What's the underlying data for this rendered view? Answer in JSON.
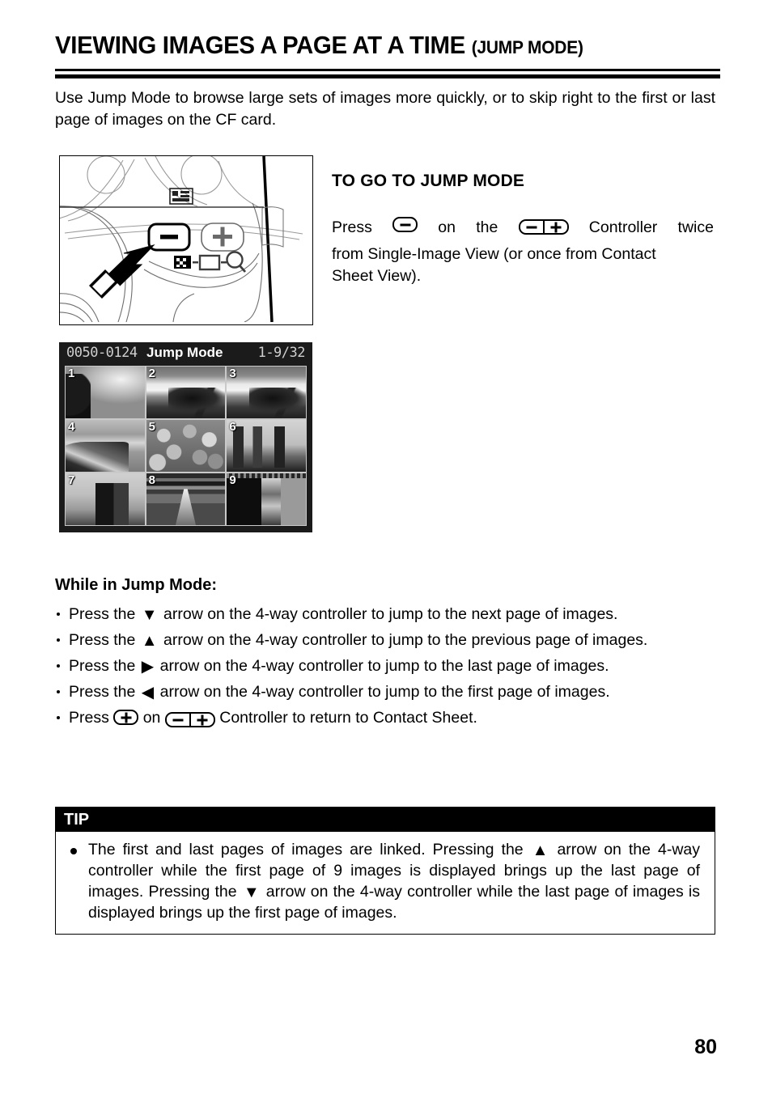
{
  "page": {
    "title_main": "VIEWING IMAGES A PAGE AT A TIME",
    "title_sub": "(JUMP MODE)",
    "number": "80"
  },
  "intro": {
    "text": "Use Jump Mode to browse large sets of images more quickly, or to skip right to the first or last page of images on the CF card."
  },
  "camera_figure": {
    "name": "camera-back-diagram",
    "minus_button_label": "−",
    "plus_button_label": "+",
    "icons": [
      "contact-sheet-icon",
      "single-image-icon",
      "magnifier-icon",
      "display-mode-icon"
    ],
    "callout": "arrow-pointing-to-minus-button"
  },
  "lcd_figure": {
    "counter": "0050-0124",
    "mode": "Jump Mode",
    "range": "1-9/32",
    "thumbnails": [
      {
        "number": "1",
        "caption": "tree-silhouette-and-clouds"
      },
      {
        "number": "2",
        "caption": "bridge-arch-and-sky"
      },
      {
        "number": "3",
        "caption": "bridge-arch-and-sky"
      },
      {
        "number": "4",
        "caption": "boat-at-shoreline"
      },
      {
        "number": "5",
        "caption": "rocks-close-up"
      },
      {
        "number": "6",
        "caption": "city-buildings"
      },
      {
        "number": "7",
        "caption": "tower-against-clouds"
      },
      {
        "number": "8",
        "caption": "railway-tracks"
      },
      {
        "number": "9",
        "caption": "dark-street-scene"
      }
    ]
  },
  "to_go_to": {
    "heading": "TO GO TO JUMP MODE",
    "line1_a": "Press",
    "line1_b": "on",
    "line1_c": "the",
    "line1_d": "Controller",
    "line1_e": "twice",
    "line2": "from Single-Image View (or once from Contact",
    "line3": "Sheet View)."
  },
  "while_in": {
    "heading": "While in Jump Mode:",
    "bullets": [
      {
        "prefix": "Press the",
        "glyph": "▼",
        "glyph_name": "down-arrow-glyph",
        "suffix": "arrow on the 4-way controller to jump to the next page of images."
      },
      {
        "prefix": "Press the",
        "glyph": "▲",
        "glyph_name": "up-arrow-glyph",
        "suffix": "arrow on the 4-way controller to jump to the previous page of images."
      },
      {
        "prefix": "Press the",
        "glyph": "▶",
        "glyph_name": "right-arrow-glyph",
        "suffix": "arrow on the 4-way controller to jump to the last page of images."
      },
      {
        "prefix": "Press the",
        "glyph": "◀",
        "glyph_name": "left-arrow-glyph",
        "suffix": "arrow on the 4-way controller to jump to the first page of images."
      }
    ],
    "last_bullet": {
      "a": "Press",
      "b": "on",
      "c": "Controller to return to Contact Sheet."
    }
  },
  "tip": {
    "header": "TIP",
    "text_a": "The first and last pages of images are linked.   Pressing the",
    "glyph_up": "▲",
    "text_b": "arrow on the 4-way controller while the first page of 9 images is displayed brings up the last page of images. Pressing the",
    "glyph_down": "▼",
    "text_c": "arrow on the 4-way controller while the last page of images is displayed brings up the first page of images."
  },
  "colors": {
    "ink": "#000000",
    "paper": "#ffffff",
    "tip_header_bg": "#000000",
    "tip_header_text": "#ffffff",
    "lcd_bg": "#1b1b1b"
  }
}
